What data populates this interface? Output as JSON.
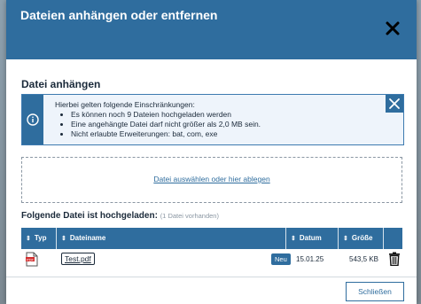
{
  "modal": {
    "title": "Dateien anhängen oder entfernen"
  },
  "attach": {
    "section_title": "Datei anhängen",
    "info": {
      "intro": "Hierbei gelten folgende Einschränkungen:",
      "items": [
        "Es können noch 9 Dateien hochgeladen werden",
        "Eine angehängte Datei darf nicht größer als 2,0 MB sein.",
        "Nicht erlaubte Erweiterungen: bat, com, exe"
      ],
      "icon": "info-icon"
    },
    "dropzone_label": "Datei auswählen oder hier ablegen"
  },
  "files": {
    "title": "Folgende Datei ist hochgeladen:",
    "count_note": "(1 Datei vorhanden)",
    "columns": {
      "typ": "Typ",
      "dateiname": "Dateiname",
      "datum": "Datum",
      "groesse": "Größe"
    },
    "rows": [
      {
        "type_icon": "pdf-icon",
        "name": "Test.pdf",
        "badge": "Neu",
        "date": "15.01.25",
        "size": "543,5 KB"
      }
    ]
  },
  "footer": {
    "close_label": "Schließen"
  },
  "colors": {
    "primary": "#2f6d9e",
    "text": "#1b2a3a"
  }
}
